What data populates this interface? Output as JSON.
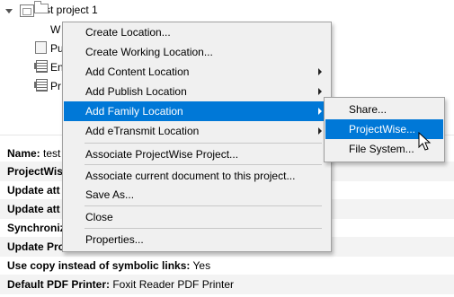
{
  "tree": {
    "root_label": "test project 1",
    "children": [
      {
        "label": "W",
        "icon": "folder-icon"
      },
      {
        "label": "Pu",
        "icon": "share-icon"
      },
      {
        "label": "En",
        "icon": "grid-icon"
      },
      {
        "label": "Pr",
        "icon": "grid-icon"
      }
    ]
  },
  "properties": [
    {
      "key": "Name:",
      "value": " test"
    },
    {
      "key": "ProjectWis",
      "value": ""
    },
    {
      "key": "Update att",
      "value": ""
    },
    {
      "key": "Update att",
      "value": ""
    },
    {
      "key": "Synchroniz",
      "value": ""
    },
    {
      "key": "Update Pro",
      "value": ""
    },
    {
      "key": "Use copy instead of symbolic links:",
      "value": " Yes"
    },
    {
      "key": "Default PDF Printer:",
      "value": " Foxit Reader PDF Printer"
    }
  ],
  "context_menu": {
    "items": [
      {
        "label": "Create Location...",
        "submenu": false
      },
      {
        "label": "Create Working Location...",
        "submenu": false
      },
      {
        "label": "Add Content Location",
        "submenu": true
      },
      {
        "label": "Add Publish Location",
        "submenu": true
      },
      {
        "label": "Add Family Location",
        "submenu": true,
        "highlighted": true
      },
      {
        "label": "Add eTransmit Location",
        "submenu": true
      },
      {
        "label": "Associate ProjectWise Project...",
        "submenu": false
      },
      {
        "label": "Associate current document to this project...",
        "submenu": false
      },
      {
        "label": "Save As...",
        "submenu": false
      },
      {
        "label": "Close",
        "submenu": false
      },
      {
        "label": "Properties...",
        "submenu": false
      }
    ]
  },
  "submenu": {
    "items": [
      {
        "label": "Share..."
      },
      {
        "label": "ProjectWise...",
        "highlighted": true
      },
      {
        "label": "File System..."
      }
    ]
  },
  "colors": {
    "highlight": "#0078d7",
    "menu_bg": "#f0f0f0"
  }
}
